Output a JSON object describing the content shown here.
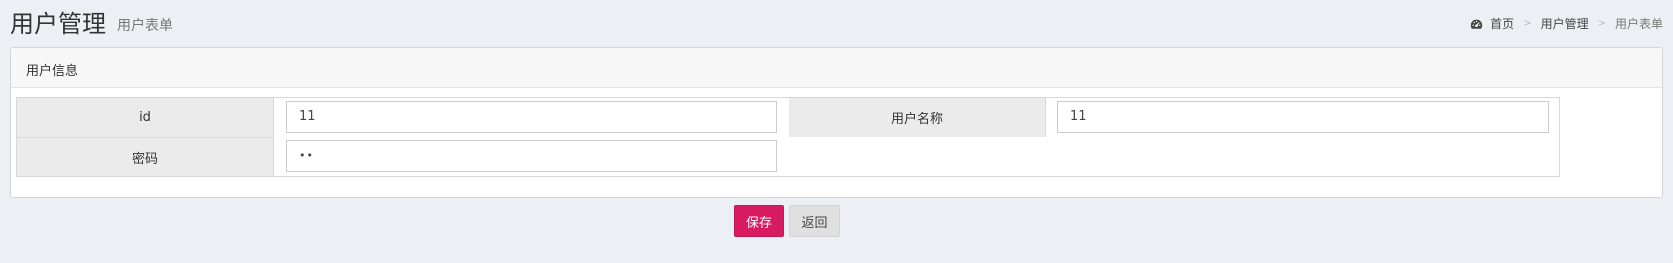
{
  "header": {
    "title": "用户管理",
    "subtitle": "用户表单"
  },
  "breadcrumb": {
    "home_icon": "dashboard-icon",
    "items": [
      "首页",
      "用户管理",
      "用户表单"
    ],
    "separator": ">"
  },
  "box": {
    "title": "用户信息"
  },
  "form": {
    "id_label": "id",
    "id_value": "11",
    "username_label": "用户名称",
    "username_value": "11",
    "password_label": "密码",
    "password_value": "••"
  },
  "actions": {
    "save_label": "保存",
    "back_label": "返回"
  },
  "colors": {
    "background": "#ecf0f5",
    "save_button": "#d81b60",
    "label_cell": "#ebebeb"
  }
}
